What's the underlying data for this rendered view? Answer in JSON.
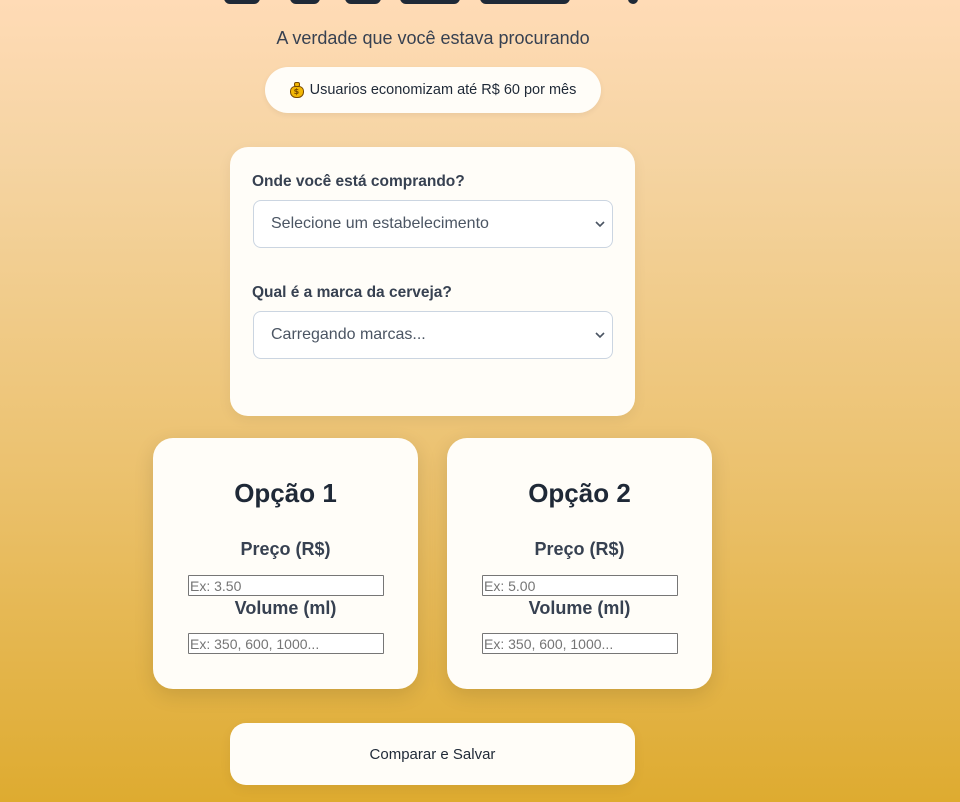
{
  "header": {
    "subtitle": "A verdade que você estava procurando",
    "savings_badge": "Usuarios economizam até R$ 60 por mês",
    "savings_icon": "money-bag-icon"
  },
  "form": {
    "store_label": "Onde você está comprando?",
    "store_select_value": "Selecione um estabelecimento",
    "brand_label": "Qual é a marca da cerveja?",
    "brand_select_value": "Carregando marcas..."
  },
  "options": [
    {
      "title": "Opção 1",
      "price_label": "Preço (R$)",
      "price_placeholder": "Ex: 3.50",
      "volume_label": "Volume (ml)",
      "volume_placeholder": "Ex: 350, 600, 1000..."
    },
    {
      "title": "Opção 2",
      "price_label": "Preço (R$)",
      "price_placeholder": "Ex: 5.00",
      "volume_label": "Volume (ml)",
      "volume_placeholder": "Ex: 350, 600, 1000..."
    }
  ],
  "actions": {
    "compare_label": "Comparar e Salvar"
  },
  "colors": {
    "background_top": "#ffdbb6",
    "background_bottom": "#deab30",
    "card": "#fffdf8",
    "text_dark": "#1f2937"
  }
}
